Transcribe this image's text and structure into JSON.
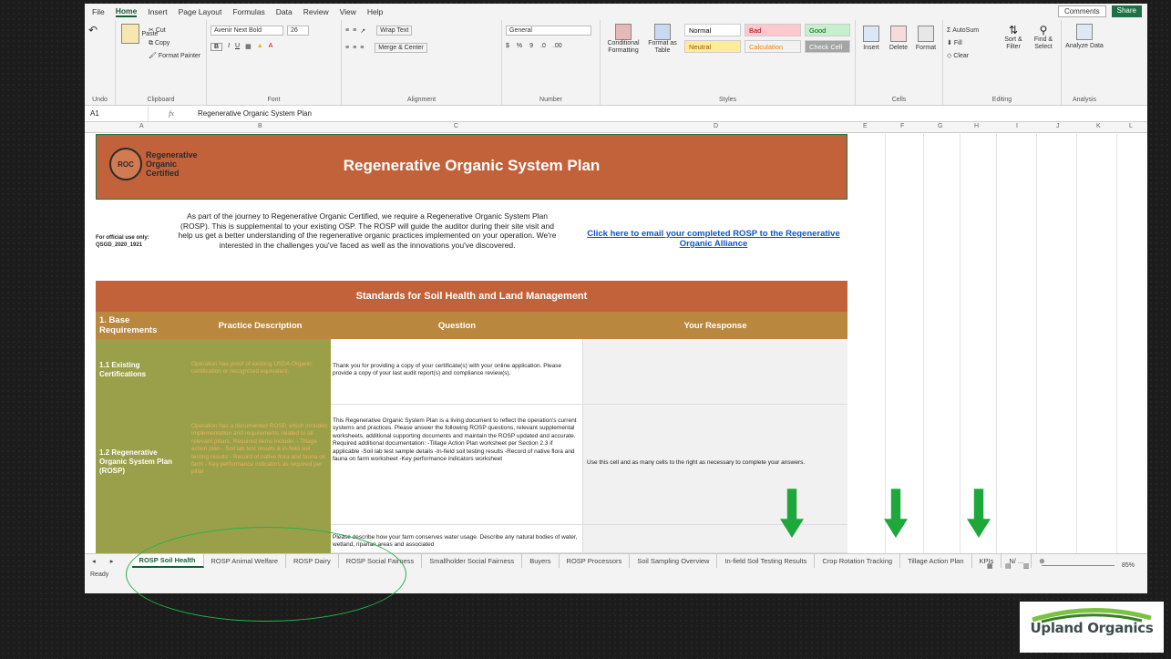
{
  "menu": [
    "File",
    "Home",
    "Insert",
    "Page Layout",
    "Formulas",
    "Data",
    "Review",
    "View",
    "Help"
  ],
  "menu_active": "Home",
  "top_right": {
    "comments": "Comments",
    "share": "Share"
  },
  "ribbon": {
    "undo": "Undo",
    "clipboard": {
      "label": "Clipboard",
      "paste": "Paste",
      "cut": "Cut",
      "copy": "Copy",
      "format_painter": "Format Painter"
    },
    "font": {
      "label": "Font",
      "name": "Avenir Next Bold",
      "size": "26",
      "bold": "B",
      "italic": "I",
      "underline": "U"
    },
    "alignment": {
      "label": "Alignment",
      "wrap": "Wrap Text",
      "merge": "Merge & Center"
    },
    "number": {
      "label": "Number",
      "format": "General",
      "currency": "$",
      "percent": "%"
    },
    "styles": {
      "label": "Styles",
      "conditional": "Conditional Formatting",
      "format_table": "Format as Table",
      "cells": [
        {
          "text": "Normal",
          "bg": "#ffffff",
          "fg": "#000000"
        },
        {
          "text": "Bad",
          "bg": "#ffc7ce",
          "fg": "#9c0006"
        },
        {
          "text": "Good",
          "bg": "#c6efce",
          "fg": "#006100"
        },
        {
          "text": "Neutral",
          "bg": "#ffeb9c",
          "fg": "#9c5700"
        },
        {
          "text": "Calculation",
          "bg": "#f2f2f2",
          "fg": "#fa7d00"
        },
        {
          "text": "Check Cell",
          "bg": "#a5a5a5",
          "fg": "#ffffff"
        }
      ]
    },
    "cells": {
      "label": "Cells",
      "insert": "Insert",
      "delete": "Delete",
      "format": "Format"
    },
    "editing": {
      "label": "Editing",
      "autosum": "AutoSum",
      "fill": "Fill",
      "clear": "Clear",
      "sort": "Sort & Filter",
      "find": "Find & Select"
    },
    "analysis": {
      "label": "Analysis",
      "analyze": "Analyze Data"
    }
  },
  "formula": {
    "namebox": "A1",
    "fx": "fx",
    "value": "Regenerative Organic System Plan"
  },
  "columns": [
    "A",
    "B",
    "C",
    "D",
    "E",
    "F",
    "G",
    "H",
    "I",
    "J",
    "K",
    "L"
  ],
  "logo": {
    "mark": "ROC",
    "line1": "Regenerative",
    "line2": "Organic",
    "line3": "Certified"
  },
  "banner_title": "Regenerative Organic System Plan",
  "official": {
    "line1": "For official use only:",
    "line2": "QSGD_2020_1921"
  },
  "intro": "As part of the journey to Regenerative Organic Certified, we require a Regenerative Organic System Plan (ROSP). This is supplemental to your existing OSP. The ROSP will guide the auditor during their site visit and help us get a better understanding of the regenerative organic practices implemented on your operation. We're interested in the challenges you've faced as well as the innovations you've discovered.",
  "email_link": "Click here to email your completed ROSP to the Regenerative Organic Alliance",
  "standards_title": "Standards for Soil Health and Land Management",
  "headers": {
    "base": "1. Base Requirements",
    "practice": "Practice Description",
    "question": "Question",
    "response": "Your Response"
  },
  "rows": [
    {
      "title": "1.1 Existing Certifications",
      "practice": "Operation has proof of existing USDA Organic certification or recognized equivalent.",
      "question": "Thank you for providing a copy of your certificate(s) with your online application. Please provide a copy of your last audit report(s) and compliance review(s).",
      "response": ""
    },
    {
      "title": "1.2 Regenerative Organic System Plan (ROSP)",
      "practice": "Operation has a documented ROSP, which includes implementation and requirements related to all relevant pillars. Required items include: - Tillage action plan - Soil lab test results & in-field soil testing results - Record of native flora and fauna on farm - Key performance indicators as required per pillar",
      "question": "This Regenerative Organic System Plan is a living document to reflect the operation's current systems and practices. Please answer the following ROSP questions, relevant supplemental worksheets, additional supporting documents and maintain the ROSP updated and accurate. Required additional documentation: -Tillage Action Plan worksheet per Section 2.3 if applicable -Soil lab test sample details -In-field soil testing results -Record of native flora and fauna on farm worksheet -Key performance indicators worksheet",
      "response": "Use this cell and as many cells to the right as necessary to complete your answers."
    },
    {
      "title": "",
      "practice": "",
      "question": "Please describe how your farm conserves water usage. Describe any natural bodies of water, wetland, riparian areas and associated",
      "response": ""
    }
  ],
  "tabs": [
    "ROSP Soil Health",
    "ROSP Animal Welfare",
    "ROSP Dairy",
    "ROSP Social Fairness",
    "Smallholder Social Fairness",
    "Buyers",
    "ROSP Processors",
    "Soil Sampling Overview",
    "In-field Soil Testing Results",
    "Crop Rotation Tracking",
    "Tillage Action Plan",
    "KPIs",
    "N/ ..."
  ],
  "active_tab": "ROSP Soil Health",
  "status": {
    "ready": "Ready",
    "zoom": "85%"
  },
  "brand": "Upland Organics",
  "accent": {
    "banner": "#c2623a",
    "header": "#b9873e",
    "olive": "#9aa04a",
    "arrow": "#1ea83c",
    "circle": "#22b14c"
  }
}
